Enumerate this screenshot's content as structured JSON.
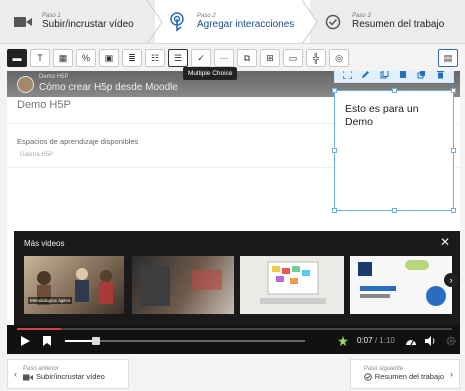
{
  "steps": [
    {
      "small": "Paso 1",
      "label": "Subir/incrustar vídeo"
    },
    {
      "small": "Paso 2",
      "label": "Agregar interacciones"
    },
    {
      "small": "Paso 3",
      "label": "Resumen del trabajo"
    }
  ],
  "toolbar": {
    "tooltip": "Multiple Choice",
    "tools": [
      "label-tool-icon",
      "text-tool-icon",
      "table-tool-icon",
      "link-tool-icon",
      "image-tool-icon",
      "statements-icon",
      "single-choice-icon",
      "multiple-choice-icon",
      "true-false-icon",
      "fill-blanks-icon",
      "drag-drop-icon",
      "drag-text-icon",
      "mark-words-icon",
      "crossroads-icon",
      "navigation-hotspot-icon",
      "questionnaire-icon"
    ]
  },
  "video": {
    "channel": "Demo H5P",
    "title": "Cómo crear H5p desde Moodle",
    "page_title": "Demo H5P",
    "spaces": "Espacios de aprendizaje disponibles",
    "gallery": "Galería H5P"
  },
  "text_element": {
    "content": "Esto es para un Demo"
  },
  "more_videos": {
    "title": "Más videos",
    "close": "✕",
    "thumbs": [
      {
        "caption": "Metodologías ágiles"
      },
      {
        "caption": ""
      },
      {
        "caption": ""
      },
      {
        "caption": ""
      }
    ]
  },
  "player": {
    "current": "0:07",
    "separator": "/",
    "duration": "1:10",
    "progress": 0.1,
    "slider_level": 0.13
  },
  "nav": {
    "prev": {
      "label": "Paso anterior",
      "dest": "Subir/incrustar vídeo"
    },
    "next": {
      "label": "Paso siguiente",
      "dest": "Resumen del trabajo"
    }
  },
  "colors": {
    "accent": "#1b4f8a",
    "selection": "#6fb0e8",
    "toolbar_blue": "#2a6dc0"
  }
}
